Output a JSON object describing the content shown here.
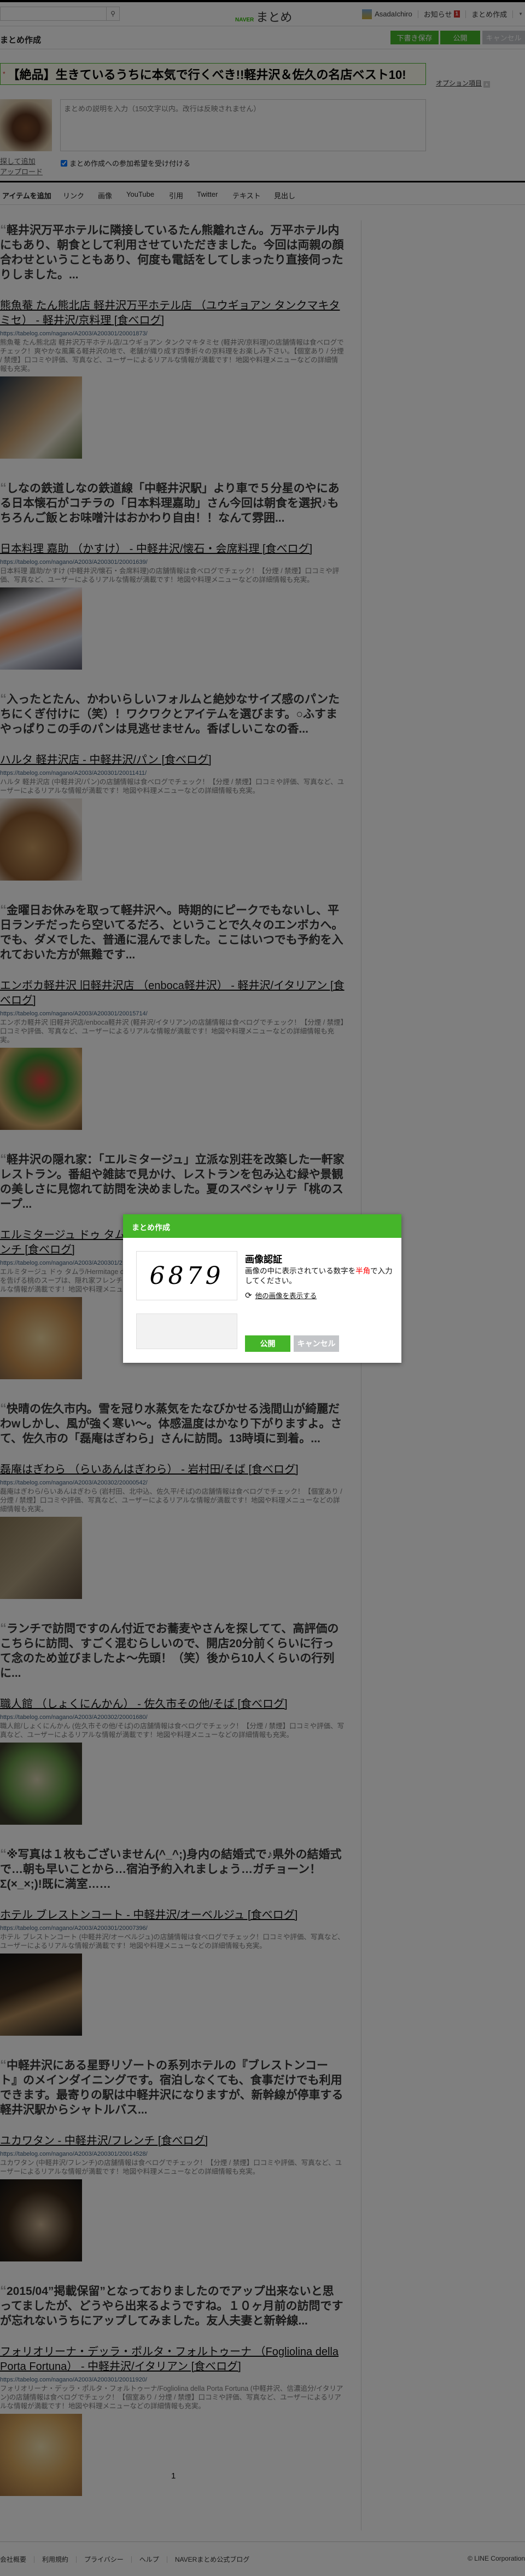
{
  "colors": {
    "accent": "#45b52a",
    "cancel": "#c3c5c8",
    "badge": "#d0312d",
    "highlight": "#ff0000"
  },
  "header": {
    "search_icon": "search-icon",
    "logo_naver": "NAVER",
    "logo_matome": "まとめ",
    "username": "AsadaIchiro",
    "notices": "お知らせ",
    "notice_count": "1",
    "create": "まとめ作成",
    "menu_icon": "chevron-down-icon"
  },
  "subheader": {
    "title": "まとめ作成",
    "save_draft": "下書き保存",
    "publish": "公開",
    "cancel": "キャンセル"
  },
  "editor": {
    "title_value": "【絶品】生きているうちに本気で行くべき!!軽井沢＆佐久の名店ベスト10!",
    "required_mark": "*",
    "options_link": "オプション項目",
    "description_placeholder": "まとめの説明を入力（150文字以内。改行は反映されません）",
    "find_image": "探して追加",
    "upload": "アップロード",
    "accept_participation": "まとめ作成への参加希望を受け付ける",
    "accept_checked": true
  },
  "add_items": {
    "label": "アイテムを追加",
    "tabs": [
      "リンク",
      "画像",
      "YouTube",
      "引用",
      "Twitter",
      "テキスト",
      "見出し"
    ]
  },
  "items": [
    {
      "quote": "軽井沢万平ホテルに隣接しているたん熊離れさん。万平ホテル内にもあり、朝食として利用させていただきました。今回は両親の顔合わせということもあり、何度も電話をしてしまったり直接伺ったりしました。...",
      "title": "熊魚菴 たん熊北店 軽井沢万平ホテル店 （ユウギョアン タンクマキタミセ） - 軽井沢/京料理 [食べログ]",
      "url": "https://tabelog.com/nagano/A2003/A200301/20001873/",
      "desc": "熊魚菴 たん熊北店 軽井沢万平ホテル店/ユウギョアン タンクマキタミセ (軽井沢/京料理)の店舗情報は食べログでチェック！爽やかな風薫る軽井沢の地で、老舗が織り成す四季折々の京料理をお楽しみ下さい。【個室あり / 分煙 / 禁煙】口コミや評価、写真など、ユーザーによるリアルな情報が満載です！地図や料理メニューなどの詳細情報も充実。",
      "img": "linear-gradient(135deg,#2b3a4a,#c9a070 45%,#e8e2d0 70%,#5a6a3a)"
    },
    {
      "quote": "しなの鉄道しなの鉄道線「中軽井沢駅」より車で５分星のやにある日本懐石がコチラの「日本料理嘉助」さん今回は朝食を選択♪もちろんご飯とお味噌汁はおかわり自由！！なんて雰囲...",
      "title": "日本料理 嘉助 （かすけ） - 中軽井沢/懐石・会席料理 [食べログ]",
      "url": "https://tabelog.com/nagano/A2003/A200301/20001639/",
      "desc": "日本料理 嘉助/かすけ (中軽井沢/懐石・会席料理)の店舗情報は食べログでチェック！【分煙 / 禁煙】口コミや評価、写真など、ユーザーによるリアルな情報が満載です！地図や料理メニューなどの詳細情報も充実。",
      "img": "linear-gradient(160deg,#333 0,#e8e8f0 25%,#f08a4a 45%,#d8dce8 70%,#556)"
    },
    {
      "quote": "入ったとたん、かわいらしいフォルムと絶妙なサイズ感のパンたちにくぎ付けに（笑）！ワクワクとアイテムを選びます。○ふすまやっぱりこの手のパンは見逃せません。香ばしいこなの香...",
      "title": "ハルタ 軽井沢店 - 中軽井沢/パン [食べログ]",
      "url": "https://tabelog.com/nagano/A2003/A200301/20011411/",
      "desc": "ハルタ 軽井沢店 (中軽井沢/パン)の店舗情報は食べログでチェック！【分煙 / 禁煙】口コミや評価、写真など、ユーザーによるリアルな情報が満載です！地図や料理メニューなどの詳細情報も充実。",
      "img": "radial-gradient(circle at 40% 60%,#c89a60,#8a5a30 50%,#e8e0d8 80%)"
    },
    {
      "quote": "金曜日お休みを取って軽井沢へ。時期的にピークでもないし、平日ランチだったら空いてるだろ、ということで久々のエンボカへ。でも、ダメでした、普通に混んでました。ここはいつでも予約を入れておいた方が無難です...",
      "title": "エンボカ軽井沢 旧軽井沢店 （enboca軽井沢） - 軽井沢/イタリアン [食べログ]",
      "url": "https://tabelog.com/nagano/A2003/A200301/20015714/",
      "desc": "エンボカ軽井沢 旧軽井沢店/enboca軽井沢 (軽井沢/イタリアン)の店舗情報は食べログでチェック！【分煙 / 禁煙】口コミや評価、写真など、ユーザーによるリアルな情報が満載です！地図や料理メニューなどの詳細情報も充実。",
      "img": "radial-gradient(circle at 50% 40%,#e04040,#3a8a30 40%,#d8b070 70%,#6a4a2a)"
    },
    {
      "quote": "軽井沢の隠れ家：「エルミタージュ」立派な別荘を改築した一軒家レストラン。番組や雑誌で見かけ、レストランを包み込む緑や景観の美しさに見惚れて訪問を決めました。夏のスペシャリテ「桃のスープ...",
      "title": "エルミタージュ ドゥ タムラ （Hermitage de Tamura） - 中軽井沢/フレンチ [食べログ]",
      "url": "https://tabelog.com/nagano/A2003/A200301/2",
      "desc_lines": [
        "エルミタージュ ドゥ タムラ/Hermitage de",
        "を告げる桃のスープは、隠れ家フレンチの",
        "ルな情報が満載です！地図や料理メニュー"
      ],
      "img": "radial-gradient(circle,#f0d8a0,#c89050 60%,#8a6a4a)"
    },
    {
      "quote": "快晴の佐久市内。雪を冠り水蒸気をたなびかせる浅間山が綺麗だわwしかし、風が強く寒い〜。体感温度はかなり下がりますよ。さて、佐久市の「磊庵はぎわら」さんに訪問。13時頃に到着。...",
      "title": "磊庵はぎわら （らいあんはぎわら） - 岩村田/そば [食べログ]",
      "url": "https://tabelog.com/nagano/A2003/A200302/20000542/",
      "desc": "磊庵はぎわら/らいあんはぎわら (岩村田、北中込、佐久平/そば)の店舗情報は食べログでチェック！【個室あり / 分煙 / 禁煙】口コミや評価、写真など、ユーザーによるリアルな情報が満載です！地図や料理メニューなどの詳細情報も充実。",
      "img": "linear-gradient(135deg,#8a7a5a,#b0a080 50%,#5a4a3a)"
    },
    {
      "quote": "ランチで訪問ですのん付近でお蕎麦やさんを探してて、高評価のこちらに訪問、すごく混むらしいので、開店20分前くらいに行って念のため並びましたよ〜先頭！（笑）後から10人くらいの行列に...",
      "title": "職人館 （しょくにんかん） - 佐久市その他/そば [食べログ]",
      "url": "https://tabelog.com/nagano/A2003/A200302/20001680/",
      "desc": "職人館/しょくにんかん (佐久市その他/そば)の店舗情報は食べログでチェック！【分煙 / 禁煙】口コミや評価、写真など、ユーザーによるリアルな情報が満載です！地図や料理メニューなどの詳細情報も充実。",
      "img": "radial-gradient(circle at 45% 45%,#d8d0b0,#6a9a4a 45%,#3a3a2a 75%)"
    },
    {
      "quote": "※写真は１枚もございません(^_^;)身内の結婚式で♪県外の結婚式で…朝も早いことから…宿泊予約入れましょう…ガチョーン！Σ(×_×;)!既に満室……",
      "title": "ホテル ブレストンコート - 中軽井沢/オーベルジュ [食べログ]",
      "url": "https://tabelog.com/nagano/A2003/A200301/20007396/",
      "desc": "ホテル ブレストンコート (中軽井沢/オーベルジュ)の店舗情報は食べログでチェック！口コミや評価、写真など、ユーザーによるリアルな情報が満載です！地図や料理メニューなどの詳細情報も充実。",
      "img": "linear-gradient(160deg,#111 0,#3a2a1a 40%,#b08a5a 60%,#1a1a1a)"
    },
    {
      "quote": "中軽井沢にある星野リゾートの系列ホテルの『ブレストンコート』のメインダイニングです。宿泊しなくても、食事だけでも利用できます。最寄りの駅は中軽井沢になりますが、新幹線が停車する軽井沢駅からシャトルバス...",
      "title": "ユカワタン - 中軽井沢/フレンチ [食べログ]",
      "url": "https://tabelog.com/nagano/A2003/A200301/20014528/",
      "desc": "ユカワタン (中軽井沢/フレンチ)の店舗情報は食べログでチェック！【分煙 / 禁煙】口コミや評価、写真など、ユーザーによるリアルな情報が満載です！地図や料理メニューなどの詳細情報も充実。",
      "img": "radial-gradient(circle at 50% 55%,#c8b090,#3a2a1a 55%,#111)"
    },
    {
      "quote": "2015/04”掲載保留”となっておりましたのでアップ出来ないと思ってましたが、どうやら出来るようですね。１０ヶ月前の訪問ですが忘れないうちにアップしてみました。友人夫妻と新幹線...",
      "title": "フォリオリーナ・デッラ・ポルタ・フォルトゥーナ （Fogliolina della Porta Fortuna） - 中軽井沢/イタリアン [食べログ]",
      "url": "https://tabelog.com/nagano/A2003/A200301/20011920/",
      "desc": "フォリオリーナ・デッラ・ポルタ・フォルトゥーナ/Fogliolina della Porta Fortuna (中軽井沢、信濃追分/イタリアン)の店舗情報は食べログでチェック！【個室あり / 分煙 / 禁煙】口コミや評価、写真など、ユーザーによるリアルな情報が満載です！地図や料理メニューなどの詳細情報も充実。",
      "img": "radial-gradient(circle at 50% 40%,#f0e0b0,#d8a860 50%,#a07040)"
    }
  ],
  "pagination": {
    "current": "1"
  },
  "footer": {
    "links": [
      "会社概要",
      "利用規約",
      "プライバシー",
      "ヘルプ",
      "NAVERまとめ公式ブログ"
    ],
    "copyright": "© LINE Corporation"
  },
  "modal": {
    "title": "まとめ作成",
    "captcha_text": "6879",
    "heading": "画像認証",
    "instruction_before": "画像の中に表示されている数字を",
    "instruction_highlight": "半角",
    "instruction_after": "で入力してください。",
    "refresh_icon": "refresh-icon",
    "refresh_link": "他の画像を表示する",
    "input_value": "",
    "publish": "公開",
    "cancel": "キャンセル"
  }
}
